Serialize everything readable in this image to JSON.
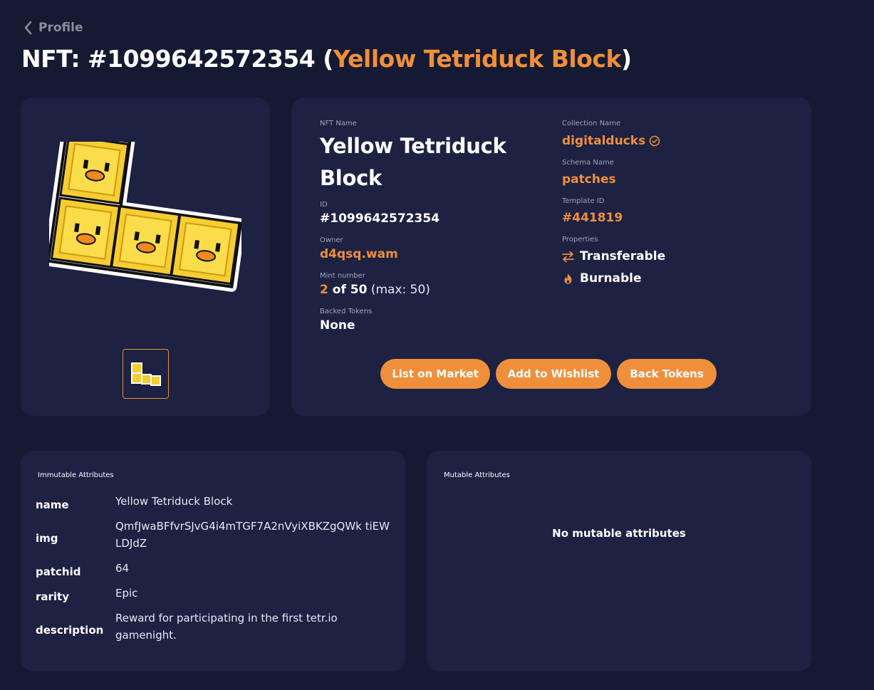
{
  "nav": {
    "back_label": "Profile"
  },
  "header": {
    "prefix": "NFT: #1099642572354 (",
    "name": "Yellow Tetriduck Block",
    "suffix": ")"
  },
  "details": {
    "nft_name_label": "NFT Name",
    "nft_name": "Yellow Tetriduck Block",
    "id_label": "ID",
    "id": "#1099642572354",
    "owner_label": "Owner",
    "owner": "d4qsq.wam",
    "mint_label": "Mint number",
    "mint_current": "2",
    "mint_of": " of 50",
    "mint_max": " (max: 50)",
    "backed_label": "Backed Tokens",
    "backed": "None",
    "collection_label": "Collection Name",
    "collection": "digitalducks",
    "schema_label": "Schema Name",
    "schema": "patches",
    "template_label": "Template ID",
    "template": "#441819",
    "properties_label": "Properties",
    "properties": [
      "Transferable",
      "Burnable"
    ]
  },
  "actions": {
    "list": "List on Market",
    "wishlist": "Add to Wishlist",
    "back_tokens": "Back Tokens"
  },
  "immutable": {
    "title": "Immutable Attributes",
    "rows": [
      {
        "key": "name",
        "value": "Yellow Tetriduck Block"
      },
      {
        "key": "img",
        "value": "QmfJwaBFfvrSJvG4i4mTGF7A2nVyiXBKZgQWk tiEWLDJdZ"
      },
      {
        "key": "patchid",
        "value": "64"
      },
      {
        "key": "rarity",
        "value": "Epic"
      },
      {
        "key": "description",
        "value": "Reward for participating in the first tetr.io gamenight."
      }
    ]
  },
  "mutable": {
    "title": "Mutable Attributes",
    "empty": "No mutable attributes"
  },
  "colors": {
    "background": "#151a33",
    "card": "#1d2142",
    "accent": "#ef8f3c"
  }
}
